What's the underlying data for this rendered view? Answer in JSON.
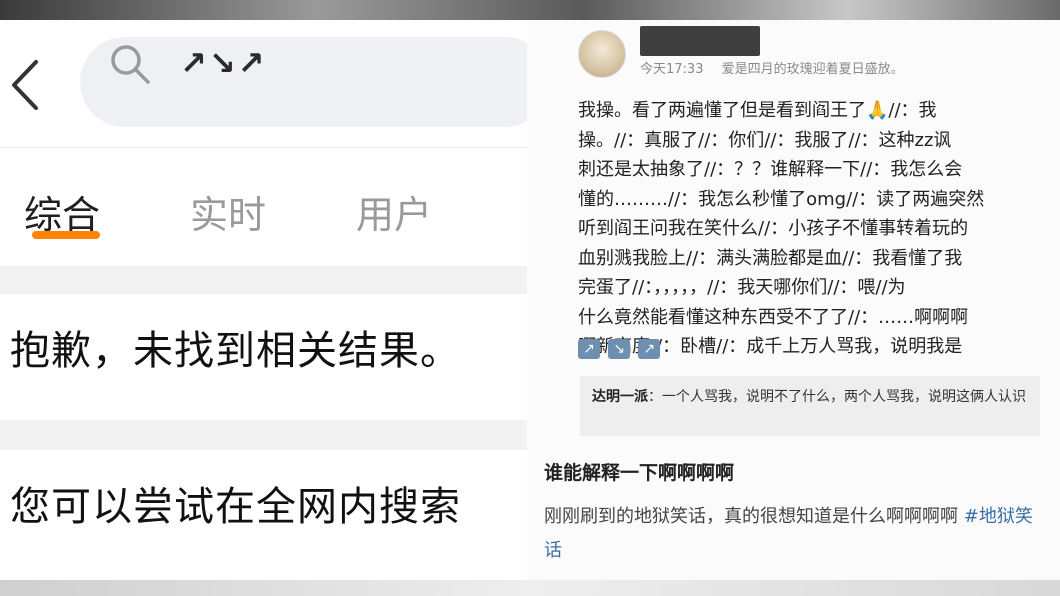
{
  "left": {
    "search": {
      "back_glyph": "‹",
      "query": "↗↘↗",
      "icon": "search-icon"
    },
    "tabs": [
      {
        "label": "综合",
        "active": true
      },
      {
        "label": "实时",
        "active": false
      },
      {
        "label": "用户",
        "active": false
      }
    ],
    "no_result_text": "抱歉，未找到相关结果。",
    "suggestion_text": "您可以尝试在全网内搜索",
    "accent_color": "#ff8200"
  },
  "right": {
    "meta": {
      "time": "今天17:33",
      "status": "爱是四月的玫瑰迎着夏日盛放。"
    },
    "post_lines": [
      "我操。看了两遍懂了但是看到阎王了🙏//：我",
      "操。//：真服了//：你们//：我服了//：这种zz讽",
      "刺还是太抽象了//：？？谁解释一下//：我怎么会",
      "懂的………//：我怎么秒懂了omg//：读了两遍突然",
      "听到阎王问我在笑什么//：小孩子不懂事转着玩的",
      "血别溅我脸上//：满头满脸都是血//：我看懂了我",
      "完蛋了//：，，，，，//：我天哪你们//：喂//为",
      "什么竟然能看懂这种东西受不了了//：……啊啊啊",
      "啊新高度//：卧槽//：成千上万人骂我，说明我是"
    ],
    "emojis": [
      "↗",
      "↘",
      "↗"
    ],
    "quote": {
      "author": "达明一派",
      "text": "：一个人骂我，说明不了什么，两个人骂我，说明这俩人认识"
    },
    "title": "谁能解释一下啊啊啊啊",
    "body": "刚刚刷到的地狱笑话，真的很想知道是什么啊啊啊啊",
    "hashtag": "#地狱笑话"
  }
}
